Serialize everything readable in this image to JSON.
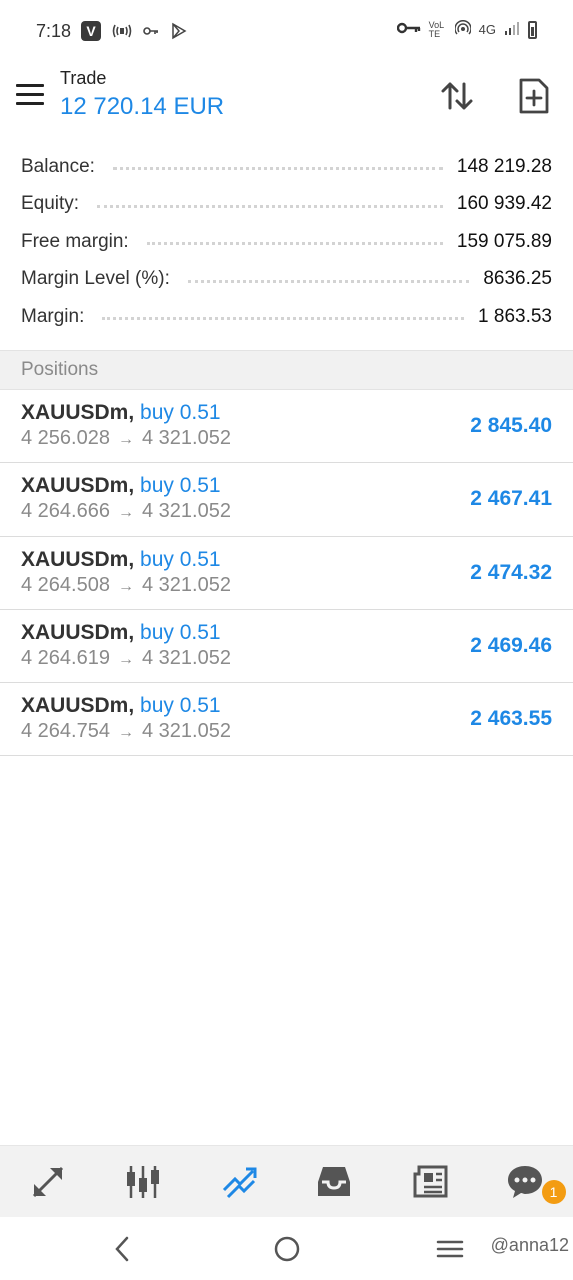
{
  "status_bar": {
    "time": "7:18",
    "left_icons": [
      "v-app-icon",
      "nfc-signal-icon",
      "key-icon",
      "play-icon"
    ],
    "network": "4G",
    "volte": "VoLTE"
  },
  "header": {
    "title": "Trade",
    "balance_display": "12 720.14 EUR",
    "accent_color": "#1e88e5"
  },
  "summary": [
    {
      "label": "Balance:",
      "value": "148 219.28"
    },
    {
      "label": "Equity:",
      "value": "160 939.42"
    },
    {
      "label": "Free margin:",
      "value": "159 075.89"
    },
    {
      "label": "Margin Level (%):",
      "value": "8636.25"
    },
    {
      "label": "Margin:",
      "value": "1 863.53"
    }
  ],
  "positions": {
    "title": "Positions",
    "items": [
      {
        "symbol": "XAUUSDm",
        "side": "buy 0.51",
        "open_price": "4 256.028",
        "current_price": "4 321.052",
        "profit": "2 845.40"
      },
      {
        "symbol": "XAUUSDm",
        "side": "buy 0.51",
        "open_price": "4 264.666",
        "current_price": "4 321.052",
        "profit": "2 467.41"
      },
      {
        "symbol": "XAUUSDm",
        "side": "buy 0.51",
        "open_price": "4 264.508",
        "current_price": "4 321.052",
        "profit": "2 474.32"
      },
      {
        "symbol": "XAUUSDm",
        "side": "buy 0.51",
        "open_price": "4 264.619",
        "current_price": "4 321.052",
        "profit": "2 469.46"
      },
      {
        "symbol": "XAUUSDm",
        "side": "buy 0.51",
        "open_price": "4 264.754",
        "current_price": "4 321.052",
        "profit": "2 463.55"
      }
    ]
  },
  "tabbar": {
    "tabs": [
      "quotes-icon",
      "chart-icon",
      "trade-icon",
      "history-icon",
      "news-icon",
      "messages-icon"
    ],
    "active_tab": "trade-icon",
    "messages_badge": "1"
  },
  "watermark": "@anna12"
}
